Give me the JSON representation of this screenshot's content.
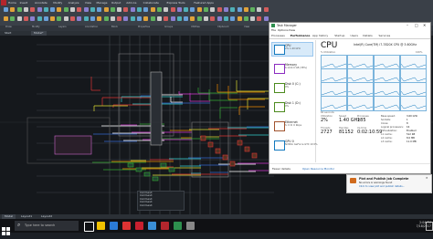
{
  "cad": {
    "ribbon_tabs": [
      "Home",
      "Insert",
      "Annotate",
      "Modify",
      "Analyze",
      "View",
      "Manage",
      "Output",
      "Add-ins",
      "Collaborate",
      "Express Tools",
      "Featured Apps"
    ],
    "panel_labels": [
      "Draw",
      "Modify",
      "Layers",
      "Annotation",
      "Block",
      "Properties",
      "Groups",
      "Utilities",
      "Clipboard",
      "View"
    ],
    "file_tabs": [
      "Start",
      "Model*"
    ],
    "layout_tabs": [
      "Model",
      "Layout1",
      "Layout2"
    ],
    "command_lines": [
      "Command:",
      "Command:",
      "Command:",
      "Command:",
      "Command:"
    ],
    "viewcube_label": "WCS"
  },
  "taskmanager": {
    "title": "Task Manager",
    "menu": [
      "File",
      "Options",
      "View"
    ],
    "tabs": [
      "Processes",
      "Performance",
      "App history",
      "Startup",
      "Users",
      "Details",
      "Services"
    ],
    "sidebar": [
      {
        "name": "CPU",
        "value": "2% 1.40 GHz"
      },
      {
        "name": "Memory",
        "value": "6.1/16.0 GB (38%)"
      },
      {
        "name": "Disk 0 (C:)",
        "value": "0%"
      },
      {
        "name": "Disk 1 (D:)",
        "value": "0%"
      },
      {
        "name": "Ethernet",
        "value": "S: 0 R: 0 Kbps"
      },
      {
        "name": "GPU 0",
        "value": "NVIDIA GeForce GTX 10 0%"
      }
    ],
    "cpu": {
      "heading": "CPU",
      "model": "Intel(R) Core(TM) i7-7820X CPU @ 3.60GHz",
      "graph_caption": "% Utilization",
      "graph_max": "100%",
      "graph_time": "60 seconds",
      "stats": [
        {
          "label": "Utilization",
          "value": "2%"
        },
        {
          "label": "Speed",
          "value": "1.40 GHz"
        },
        {
          "label": "Processes",
          "value": "185"
        },
        {
          "label": "Threads",
          "value": "2727"
        },
        {
          "label": "Handles",
          "value": "81152"
        },
        {
          "label": "Up time",
          "value": "0:02:10:59"
        }
      ],
      "specs": [
        [
          "Base speed:",
          "3.60 GHz"
        ],
        [
          "Sockets:",
          "1"
        ],
        [
          "Cores:",
          "8"
        ],
        [
          "Logical processors:",
          "16"
        ],
        [
          "Virtualization:",
          "Enabled"
        ],
        [
          "L1 cache:",
          "512 KB"
        ],
        [
          "L2 cache:",
          "8.0 MB"
        ],
        [
          "L3 cache:",
          "11.0 MB"
        ]
      ]
    },
    "footer_less": "Fewer details",
    "footer_link": "Open Resource Monitor"
  },
  "notification": {
    "title": "Plot and Publish Job Complete",
    "line1": "No errors or warnings found",
    "line2": "Click to view plot and publish details..."
  },
  "taskbar": {
    "search_placeholder": "Type here to search",
    "clock_time": "2:04 PM",
    "clock_date": "7/18/2017"
  }
}
